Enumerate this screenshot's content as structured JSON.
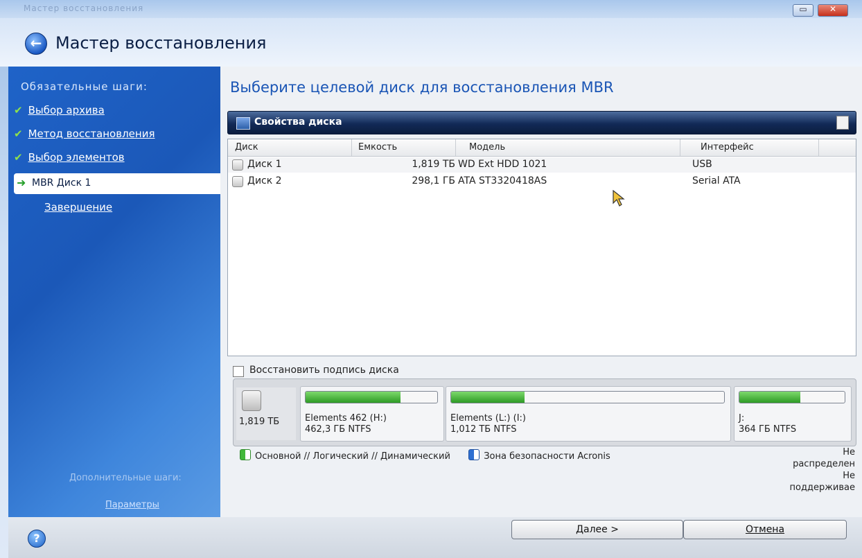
{
  "titlebar": {
    "title": "Мастер восстановления"
  },
  "header": {
    "title": "Мастер восстановления"
  },
  "sidebar": {
    "required_heading": "Обязательные шаги:",
    "steps": [
      {
        "label": "Выбор архива",
        "done": true
      },
      {
        "label": "Метод восстановления",
        "done": true
      },
      {
        "label": "Выбор элементов",
        "done": true
      }
    ],
    "current_step": "MBR Диск 1",
    "finish_step": "Завершение",
    "extra_heading": "Дополнительные шаги:",
    "extra_link": "Параметры"
  },
  "main": {
    "title": "Выберите целевой диск для восстановления MBR",
    "properties_label": "Свойства диска",
    "columns": [
      "Диск",
      "Емкость",
      "Модель",
      "Интерфейс"
    ],
    "rows": [
      {
        "disk": "Диск 1",
        "capacity": "1,819 ТБ",
        "model": "WD Ext HDD 1021",
        "interface": "USB"
      },
      {
        "disk": "Диск 2",
        "capacity": "298,1 ГБ",
        "model": "ATA ST3320418AS",
        "interface": "Serial ATA"
      }
    ],
    "restore_signature_label": "Восстановить подпись диска",
    "disk_map": {
      "disk_size": "1,819 ТБ",
      "partitions": [
        {
          "name": "Elements 462 (H:)",
          "info": "462,3 ГБ  NTFS",
          "used": 0.72
        },
        {
          "name": "Elements (L:) (I:)",
          "info": "1,012 ТБ  NTFS",
          "used": 0.27
        },
        {
          "name": "J:",
          "info": "364 ГБ  NTFS",
          "used": 0.58
        }
      ]
    },
    "legend": {
      "primary": "Основной // Логический // Динамический",
      "acronis": "Зона безопасности Acronis",
      "right": "Не распределен Не поддерживае"
    }
  },
  "footer": {
    "next_label": "Далее >",
    "cancel_label": "Отмена"
  },
  "colors": {
    "accent": "#1a55b5",
    "sidebar": "#1f63c8",
    "partition_fill": "#2e9b25"
  }
}
